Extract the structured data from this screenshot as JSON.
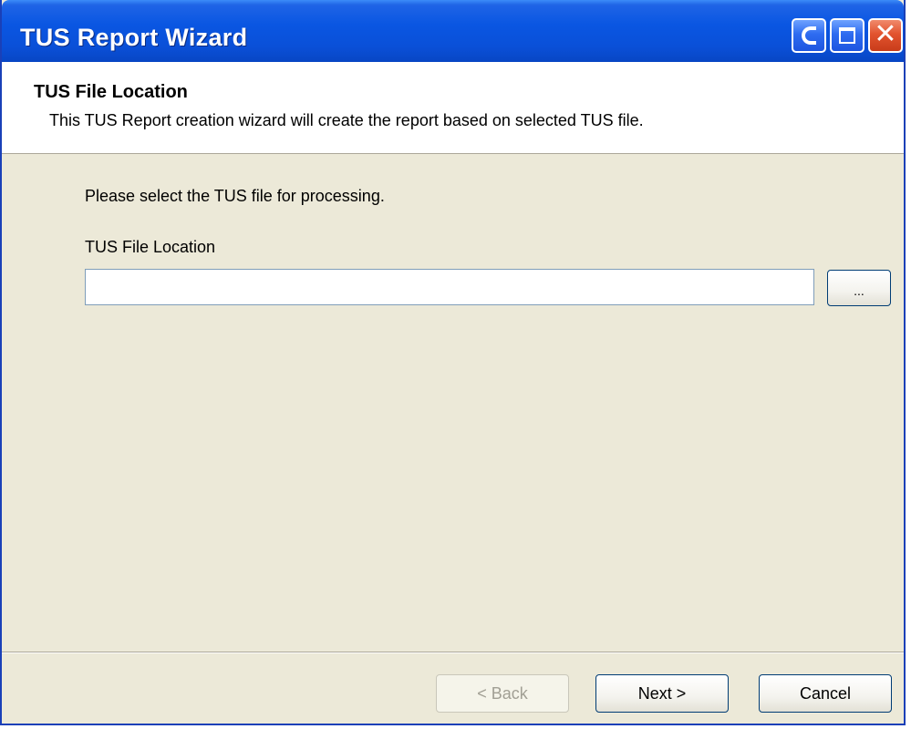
{
  "window": {
    "title": "TUS Report Wizard",
    "caption_buttons": {
      "help_icon": "help-icon",
      "maximize_icon": "maximize-icon",
      "close_icon": "close-icon",
      "close_glyph": "✕"
    }
  },
  "header": {
    "title": "TUS File Location",
    "subtitle": "This TUS Report creation wizard will create the report based on selected TUS file."
  },
  "body": {
    "instruction": "Please select the TUS file for processing.",
    "field_label": "TUS File Location",
    "field_value": "",
    "field_placeholder": "",
    "browse_label": "..."
  },
  "footer": {
    "back_label": "< Back",
    "back_enabled": false,
    "next_label": "Next >",
    "cancel_label": "Cancel"
  },
  "colors": {
    "titlebar": "#0a56e2",
    "dialog_background": "#ece9d8",
    "close_button": "#e2532e",
    "button_border": "#003c74"
  }
}
